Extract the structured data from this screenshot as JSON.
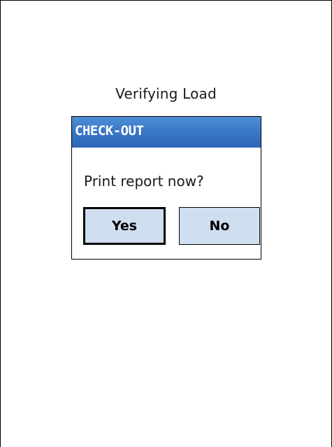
{
  "screen": {
    "caption": "Verifying Load"
  },
  "dialog": {
    "title": "CHECK-OUT",
    "message": "Print report now?",
    "buttons": {
      "yes_label": "Yes",
      "no_label": "No"
    }
  },
  "colors": {
    "titlebar": "#3a78c8",
    "button_fill": "#cfdff0"
  }
}
